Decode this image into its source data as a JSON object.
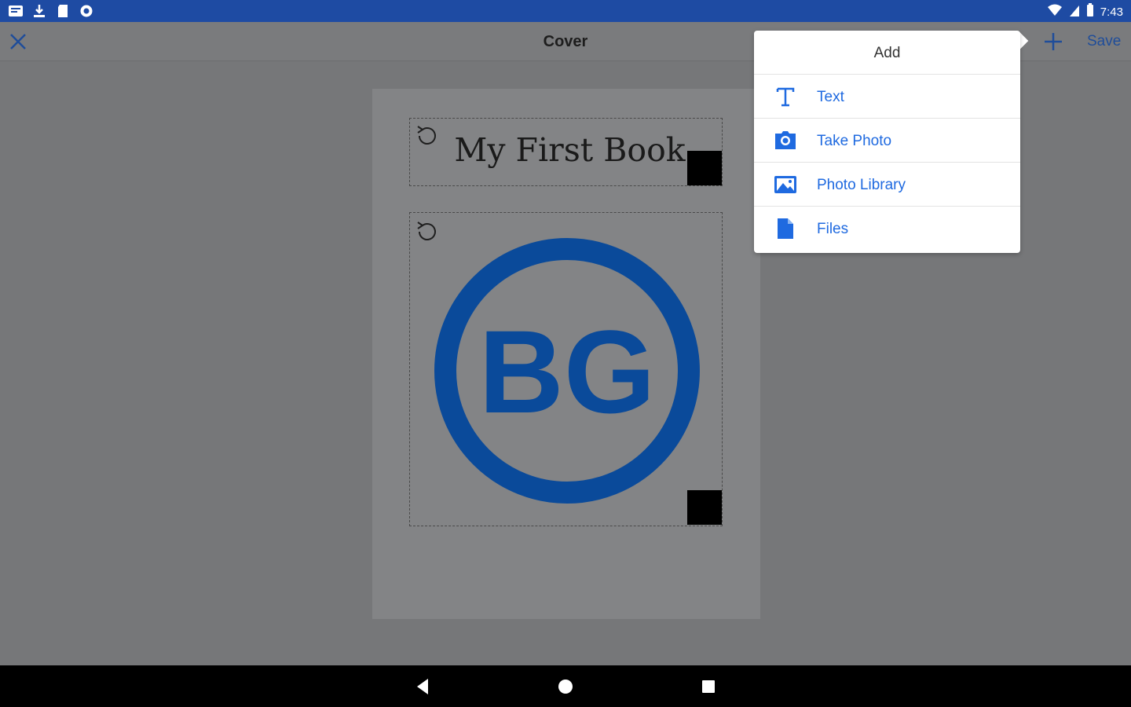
{
  "status_bar": {
    "left_icons": [
      "gallery-notification-icon",
      "download-icon",
      "sd-card-icon",
      "sync-circle-icon"
    ],
    "right_icons": [
      "wifi-icon",
      "cell-signal-icon",
      "battery-icon"
    ],
    "time": "7:43"
  },
  "toolbar": {
    "close_icon": "close-icon",
    "title": "Cover",
    "add_icon": "plus-icon",
    "save_label": "Save"
  },
  "cover": {
    "title_text": "My First Book",
    "logo_text": "BG"
  },
  "add_menu": {
    "header": "Add",
    "items": [
      {
        "label": "Text",
        "icon": "text-icon"
      },
      {
        "label": "Take Photo",
        "icon": "camera-icon"
      },
      {
        "label": "Photo Library",
        "icon": "photo-library-icon"
      },
      {
        "label": "Files",
        "icon": "file-icon"
      }
    ]
  },
  "colors": {
    "status_bar": "#1e4ba3",
    "accent_blue": "#1f6ae0",
    "logo_blue": "#0a4a9a",
    "overlay_gray": "#767779"
  },
  "navigation": {
    "icons": [
      "back-icon",
      "home-icon",
      "recents-icon"
    ]
  }
}
